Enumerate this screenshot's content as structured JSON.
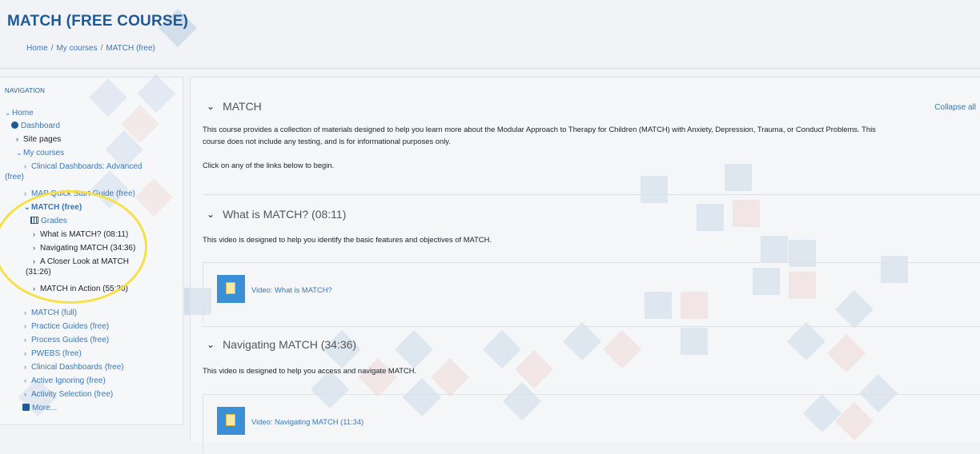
{
  "page": {
    "title": "MATCH (FREE COURSE)",
    "breadcrumb": [
      "Home",
      "My courses",
      "MATCH (free)"
    ]
  },
  "navigation": {
    "heading": "NAVIGATION",
    "items": [
      {
        "label": "Home",
        "chevron": "v",
        "icon": "chevron-down-icon"
      },
      {
        "label": "Dashboard",
        "icon": "dashboard-icon"
      },
      {
        "label": "Site pages",
        "chevron": ">"
      },
      {
        "label": "My courses",
        "chevron": "v"
      },
      {
        "label": "Clinical Dashboards: Advanced",
        "label2": "(free)",
        "chevron": ">"
      },
      {
        "label": "MAP Quick Start Guide (free)",
        "chevron": ">"
      },
      {
        "label": "MATCH (free)",
        "chevron": "v"
      },
      {
        "label": "Grades",
        "icon": "grades-table-icon"
      },
      {
        "label": "What is MATCH? (08:11)",
        "chevron": ">"
      },
      {
        "label": "Navigating MATCH (34:36)",
        "chevron": ">"
      },
      {
        "label": "A Closer Look at MATCH",
        "label2": "(31:26)",
        "chevron": ">"
      },
      {
        "label": "MATCH in Action (55:30)",
        "chevron": ">"
      },
      {
        "label": "MATCH (full)",
        "chevron": ">"
      },
      {
        "label": "Practice Guides (free)",
        "chevron": ">"
      },
      {
        "label": "Process Guides (free)",
        "chevron": ">"
      },
      {
        "label": "PWEBS (free)",
        "chevron": ">"
      },
      {
        "label": "Clinical Dashboards (free)",
        "chevron": ">"
      },
      {
        "label": "Active Ignoring (free)",
        "chevron": ">"
      },
      {
        "label": "Activity Selection (free)",
        "chevron": ">"
      },
      {
        "label": "More...",
        "icon": "more-square-icon"
      }
    ]
  },
  "main": {
    "collapse_all": "Collapse all",
    "sections": [
      {
        "title": "MATCH",
        "toggle": "❯",
        "paragraphs": [
          "This course provides a collection of materials designed to help you learn more about the Modular Approach to Therapy for Children (MATCH) with Anxiety, Depression, Trauma, or Conduct Problems. This",
          "course does not include any testing, and is for informational purposes only.",
          "Click on any of the links below to begin."
        ]
      },
      {
        "title": "What is MATCH? (08:11)",
        "toggle": "❯",
        "paragraphs": [
          "This video is designed to help you identify the basic features and objectives of MATCH."
        ],
        "activity": "Video: What is MATCH?"
      },
      {
        "title": "Navigating MATCH (34:36)",
        "toggle": "❯",
        "paragraphs": [
          "This video is designed to help you access and navigate MATCH."
        ],
        "activity": "Video: Navigating MATCH (11:34)"
      }
    ]
  },
  "colors": {
    "title_blue": "#1f5a96",
    "link_blue": "#3a77b8",
    "highlight_ring": "#f6e04a",
    "activity_icon": "#3b8fd6"
  }
}
